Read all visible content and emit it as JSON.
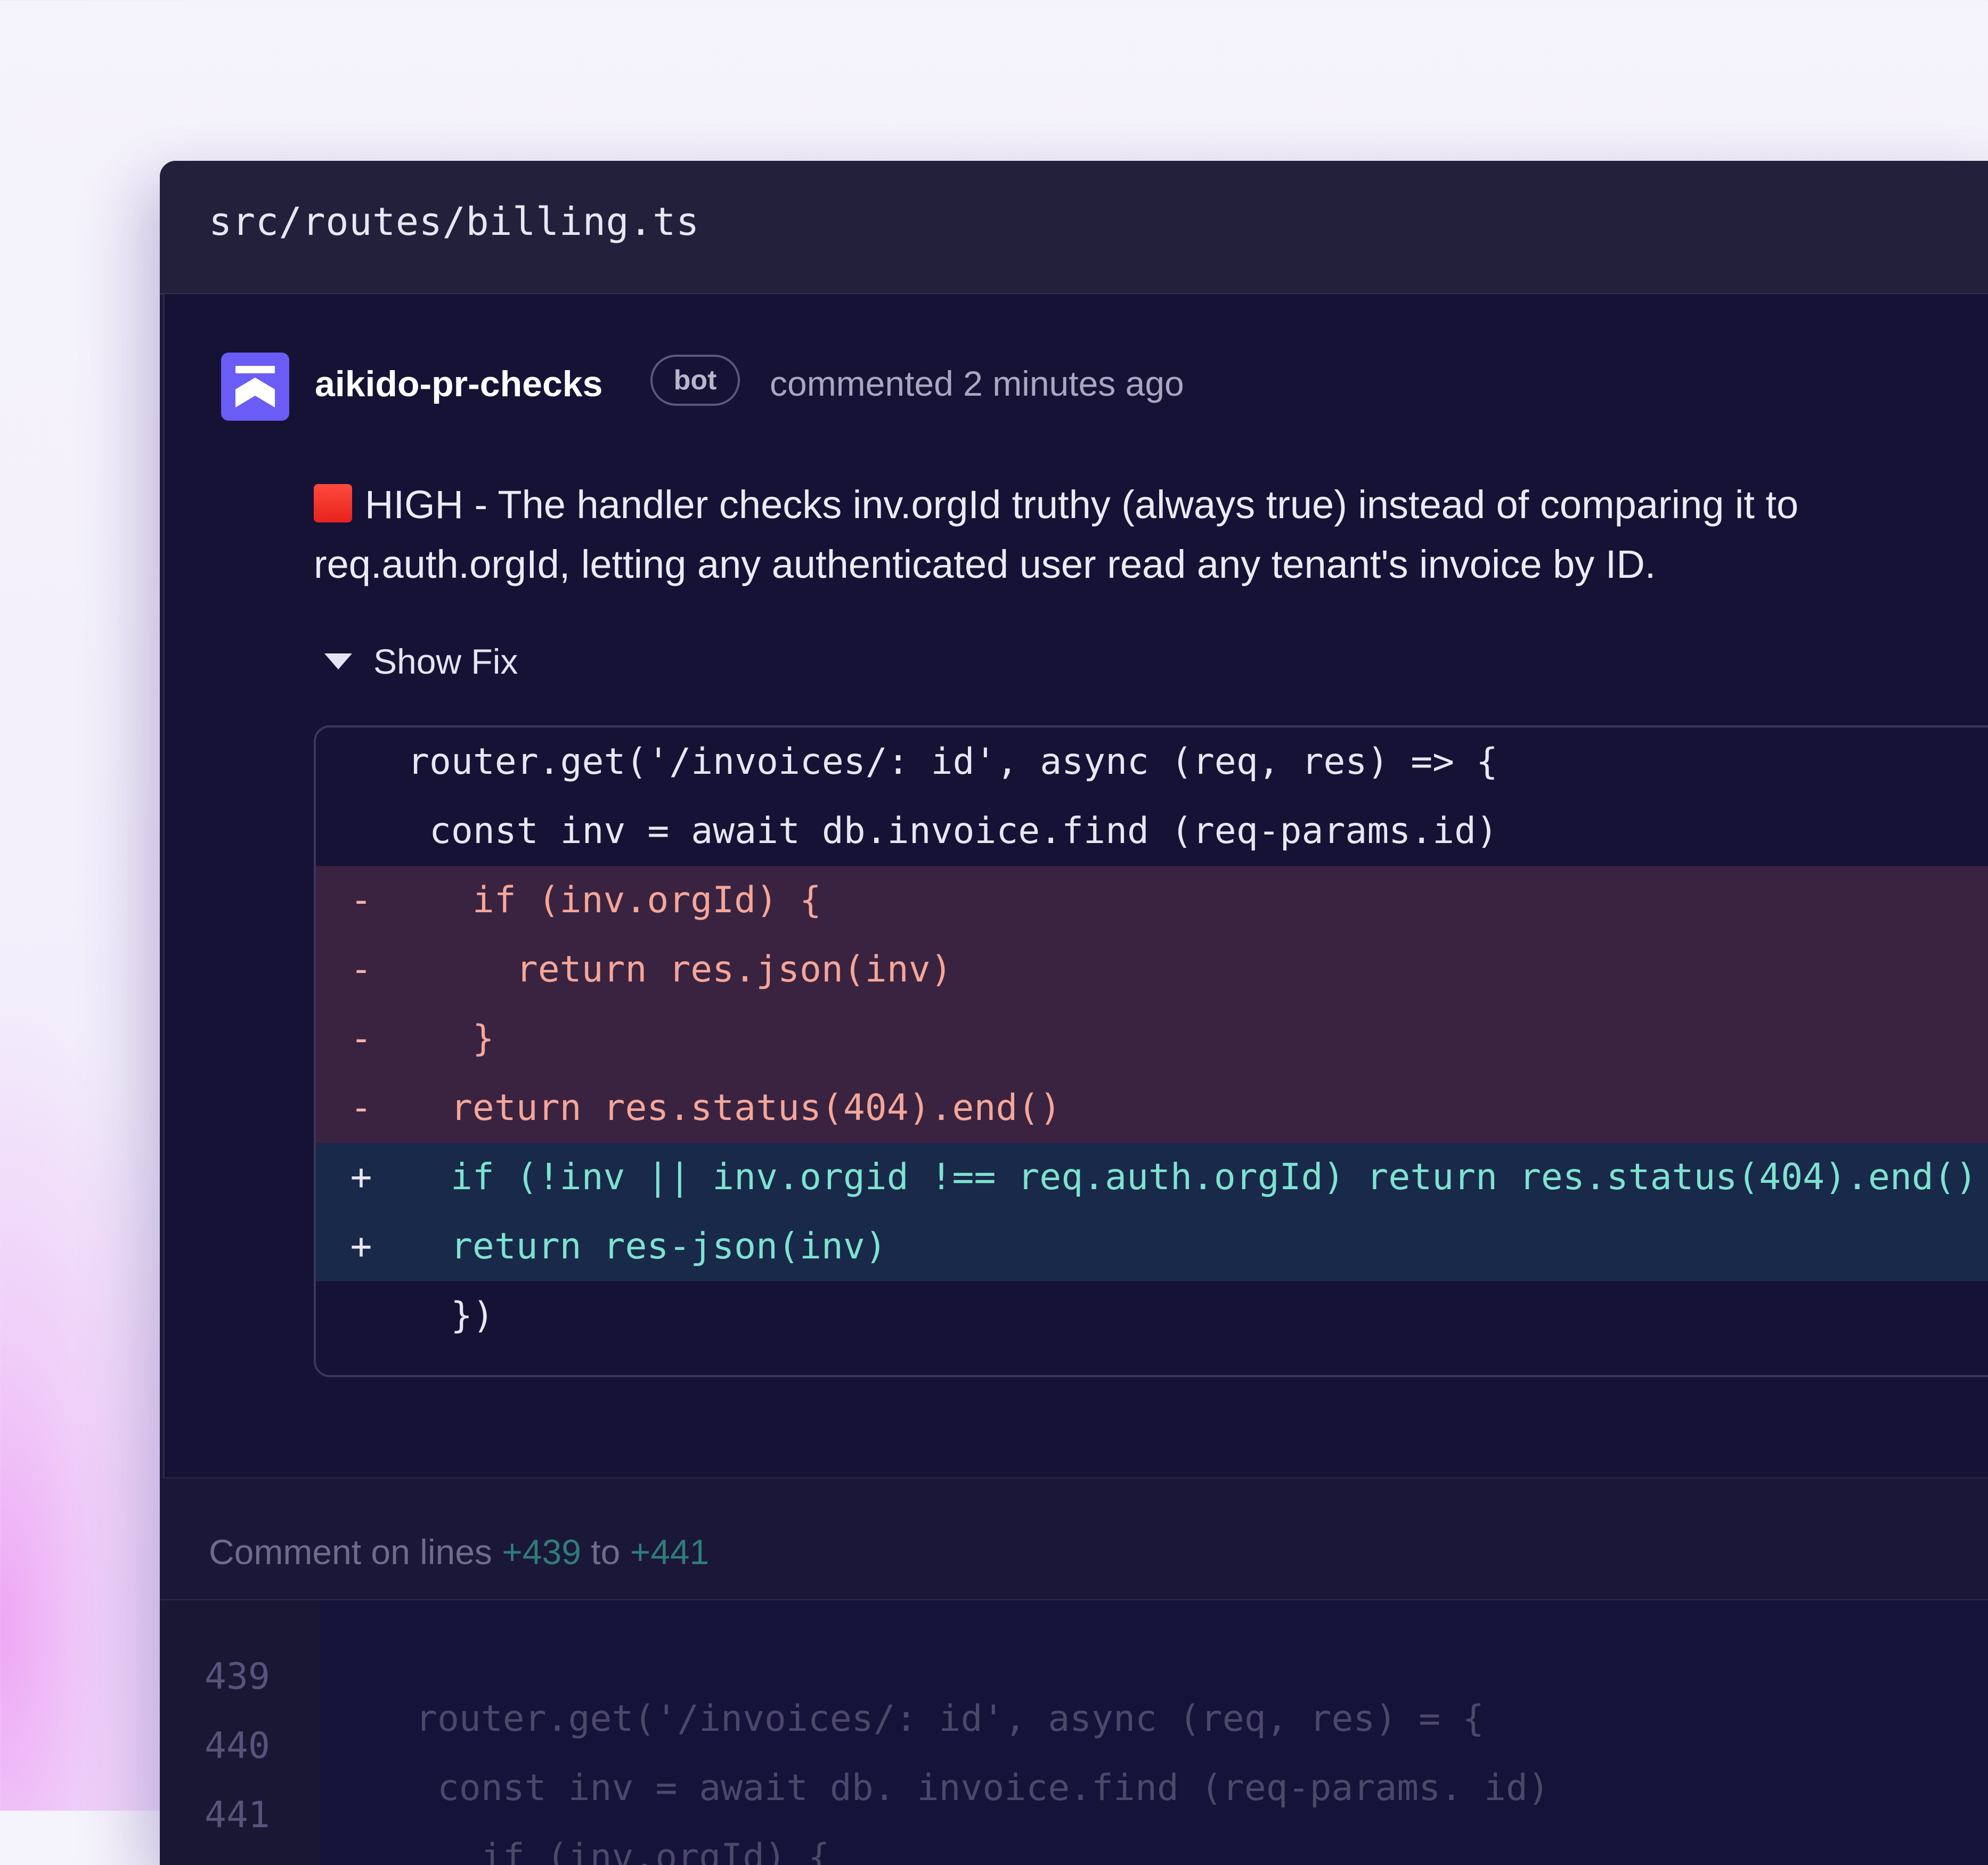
{
  "file": {
    "path": "src/routes/billing.ts"
  },
  "comment": {
    "author": "aikido-pr-checks",
    "badge": "bot",
    "meta": "commented 2 minutes ago",
    "severity_color": "#e6231c",
    "message": "HIGH - The handler checks inv.orgId truthy (always true) instead of comparing it to req.auth.orgId, letting any authenticated user read any tenant's invoice by ID.",
    "toggle_label": "Show Fix",
    "toggle_icon": "caret-down-icon"
  },
  "diff": {
    "lines": [
      {
        "type": "ctx",
        "sign": "",
        "code": "router.get('/invoices/: id', async (req, res) => {"
      },
      {
        "type": "ctx",
        "sign": "",
        "code": " const inv = await db.invoice.find (req-params.id)"
      },
      {
        "type": "del",
        "sign": "-",
        "code": "  if (inv.orgId) {"
      },
      {
        "type": "del",
        "sign": "-",
        "code": "    return res.json(inv)"
      },
      {
        "type": "del",
        "sign": "-",
        "code": "  }"
      },
      {
        "type": "del",
        "sign": "-",
        "code": " return res.status(404).end()"
      },
      {
        "type": "add",
        "sign": "+",
        "code": " if (!inv || inv.orgid !== req.auth.orgId) return res.status(404).end()"
      },
      {
        "type": "add",
        "sign": "+",
        "code": " return res-json(inv)"
      },
      {
        "type": "ctx",
        "sign": "",
        "code": " })"
      }
    ]
  },
  "lower": {
    "comment_prefix": "Comment on lines",
    "line_start": "+439",
    "line_to": "to",
    "line_end": "+441",
    "rows": [
      {
        "num": "439",
        "code": "router.get('/invoices/: id', async (req, res) = {"
      },
      {
        "num": "440",
        "code": " const inv = await db. invoice.find (req-params. id)"
      },
      {
        "num": "441",
        "code": "   if (inv.orgId) {"
      }
    ]
  },
  "colors": {
    "accent": "#6a5cf5",
    "deleted_bg": "#3a2340",
    "deleted_text": "#f4a699",
    "added_bg": "#19294a",
    "added_text": "#7de3cf"
  }
}
